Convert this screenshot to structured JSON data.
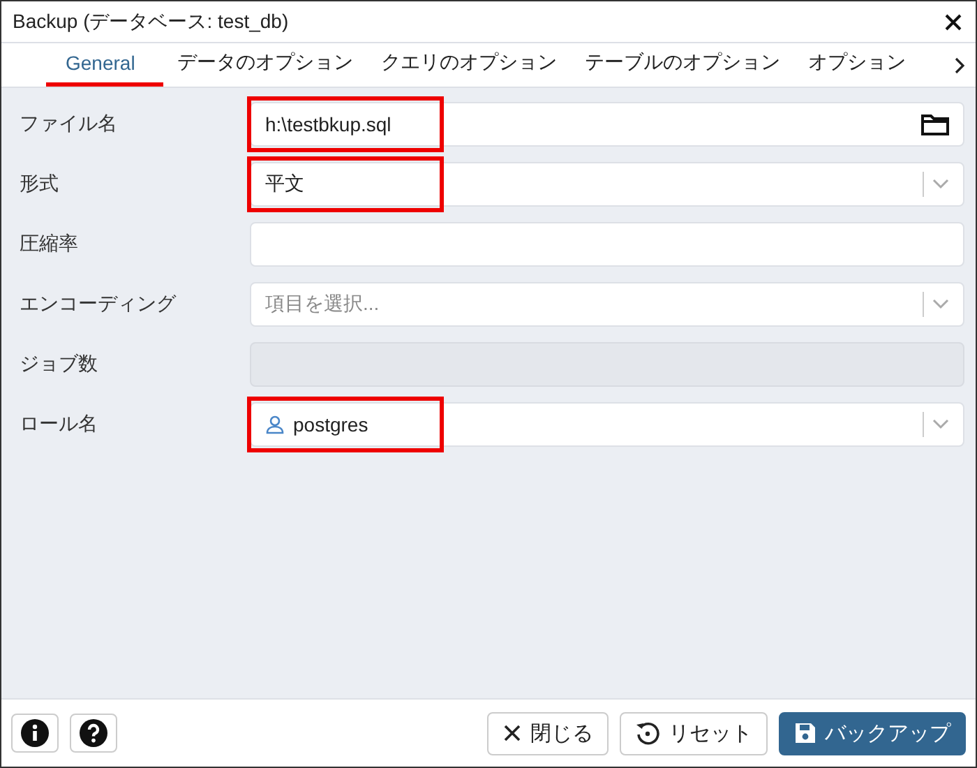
{
  "window": {
    "title": "Backup (データベース: test_db)"
  },
  "tabs": [
    {
      "label": "General",
      "selected": true
    },
    {
      "label": "データのオプション",
      "selected": false
    },
    {
      "label": "クエリのオプション",
      "selected": false
    },
    {
      "label": "テーブルのオプション",
      "selected": false
    },
    {
      "label": "オプション",
      "selected": false
    }
  ],
  "fields": [
    {
      "label": "ファイル名",
      "kind": "file",
      "value": "h:\\testbkup.sql",
      "highlighted": true,
      "disabled": false
    },
    {
      "label": "形式",
      "kind": "select",
      "value": "平文",
      "highlighted": true,
      "disabled": false
    },
    {
      "label": "圧縮率",
      "kind": "text",
      "highlighted": false,
      "disabled": false
    },
    {
      "label": "エンコーディング",
      "kind": "select",
      "placeholder": "項目を選択...",
      "highlighted": false,
      "disabled": false
    },
    {
      "label": "ジョブ数",
      "kind": "text",
      "highlighted": false,
      "disabled": true
    },
    {
      "label": "ロール名",
      "kind": "user-select",
      "value": "postgres",
      "highlighted": true,
      "disabled": false
    }
  ],
  "buttons": [
    {
      "label": "閉じる",
      "kind": "close"
    },
    {
      "label": "リセット",
      "kind": "reset"
    },
    {
      "label": "バックアップ",
      "kind": "primary"
    }
  ]
}
